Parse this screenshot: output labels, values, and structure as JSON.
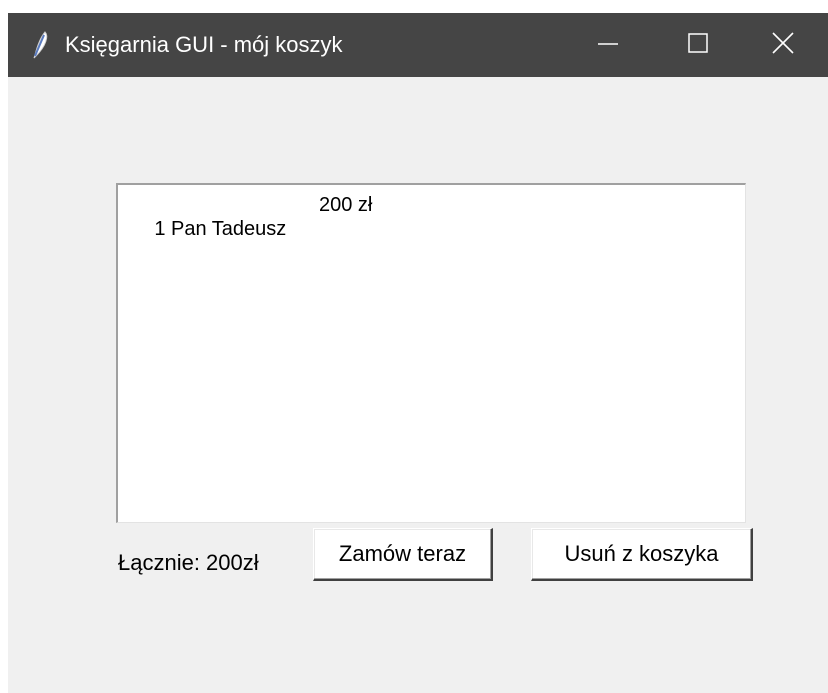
{
  "window": {
    "title": "Księgarnia GUI - mój koszyk",
    "app_icon": "feather-icon",
    "controls": {
      "minimize_icon": "minimize-icon",
      "maximize_icon": "maximize-icon",
      "close_icon": "close-icon"
    }
  },
  "cart": {
    "items": [
      {
        "label": "1 Pan Tadeusz",
        "price": "200 zł"
      }
    ]
  },
  "footer": {
    "total_label": "Łącznie: 200zł",
    "order_button": "Zamów teraz",
    "remove_button": "Usuń z koszyka"
  },
  "colors": {
    "titlebar": "#454545",
    "window_bg": "#f0f0f0",
    "list_bg": "#ffffff"
  }
}
